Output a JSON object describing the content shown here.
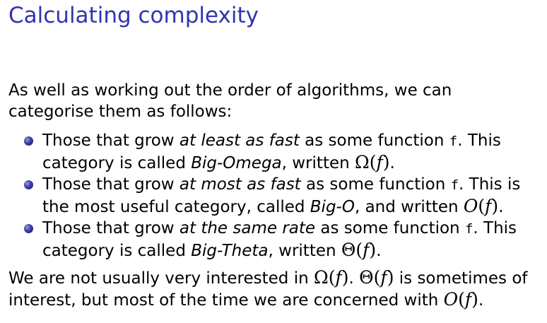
{
  "title": "Calculating complexity",
  "intro": "As well as working out the order of algorithms, we can categorise them as follows:",
  "bullets": [
    {
      "pre": "Those that grow ",
      "emph": "at least as fast",
      "mid": " as some function ",
      "code": "f",
      "post1": ". This category is called ",
      "name": "Big-Omega",
      "post2": ", written ",
      "sym": "Ω",
      "arg": "f",
      "end": "."
    },
    {
      "pre": "Those that grow ",
      "emph": "at most as fast",
      "mid": " as some function ",
      "code": "f",
      "post1": ". This is the most useful category, called ",
      "name": "Big-O",
      "post2": ", and written ",
      "sym": "O",
      "arg": "f",
      "end": "."
    },
    {
      "pre": "Those that grow ",
      "emph": "at the same rate",
      "mid": " as some function ",
      "code": "f",
      "post1": ". This category is called ",
      "name": "Big-Theta",
      "post2": ", written ",
      "sym": "Θ",
      "arg": "f",
      "end": "."
    }
  ],
  "closing": {
    "a": "We are not usually very interested in ",
    "sym1": "Ω",
    "arg1": "f",
    "b": ". ",
    "sym2": "Θ",
    "arg2": "f",
    "c": " is sometimes of interest, but most of the time we are concerned with ",
    "sym3": "O",
    "arg3": "f",
    "d": "."
  },
  "colors": {
    "title": "#3333b3",
    "bullet": "#3a3aa6"
  },
  "icons": {
    "bullet": "bullet-ball-icon"
  }
}
